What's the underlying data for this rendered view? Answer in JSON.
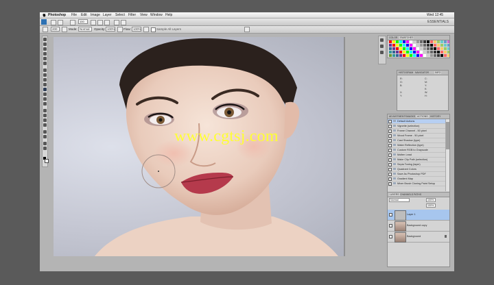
{
  "menubar": {
    "app": "Photoshop",
    "items": [
      "File",
      "Edit",
      "Image",
      "Layer",
      "Select",
      "Filter",
      "View",
      "Window",
      "Help"
    ],
    "clock": "Wed 12:45"
  },
  "appbar": {
    "zoom": "100",
    "workspace": "ESSENTIALS"
  },
  "options": {
    "brush_size": "200",
    "mode_label": "Mode:",
    "mode_value": "Normal",
    "opacity_label": "Opacity:",
    "opacity_value": "100%",
    "flow_label": "Flow:",
    "flow_value": "100%",
    "sample_label": "Sample All Layers"
  },
  "document": {
    "watermark": "www.cgtsj.com"
  },
  "panels": {
    "color_tabs": [
      "COLOR",
      "SWATCHES"
    ],
    "nav_tabs": [
      "HISTOGRAM",
      "NAVIGATOR",
      "INFO"
    ],
    "info_values": [
      "R:",
      "G:",
      "B:",
      "X:",
      "Y:",
      "C:",
      "M:",
      "Y:",
      "K:",
      "W:",
      "H:"
    ],
    "history_tabs": [
      "ADJUSTMENTS",
      "MASKS",
      "ACTIONS",
      "HISTORY"
    ],
    "history_rows": [
      "Default Actions",
      "Vignette (selection)",
      "Frame Channel - 50 pixel",
      "Wood Frame - 50 pixel",
      "Cast Shadow (type)",
      "Water Reflection (type)",
      "Custom RGB to Grayscale",
      "Molten Lead",
      "Make Clip Path (selection)",
      "Sepia Toning (layer)",
      "Quadrant Colors",
      "Save As Photoshop PDF",
      "Gradient Map",
      "Mixer Brush Cloning Paint Setup"
    ],
    "layers_tabs": [
      "LAYERS",
      "CHANNELS",
      "PATHS"
    ],
    "blend_mode": "Normal",
    "opacity": "100%",
    "fill": "100%",
    "layers": [
      {
        "name": "Layer 1"
      },
      {
        "name": "Background copy"
      },
      {
        "name": "Background"
      }
    ]
  },
  "colors": {
    "ps_blue": "#2d71b3",
    "selection": "#a7c6ee",
    "watermark": "#ffff33"
  },
  "icons": [
    "apple-icon",
    "move-tool-icon",
    "marquee-tool-icon",
    "lasso-tool-icon",
    "brush-tool-icon",
    "eye-icon",
    "folder-icon"
  ]
}
